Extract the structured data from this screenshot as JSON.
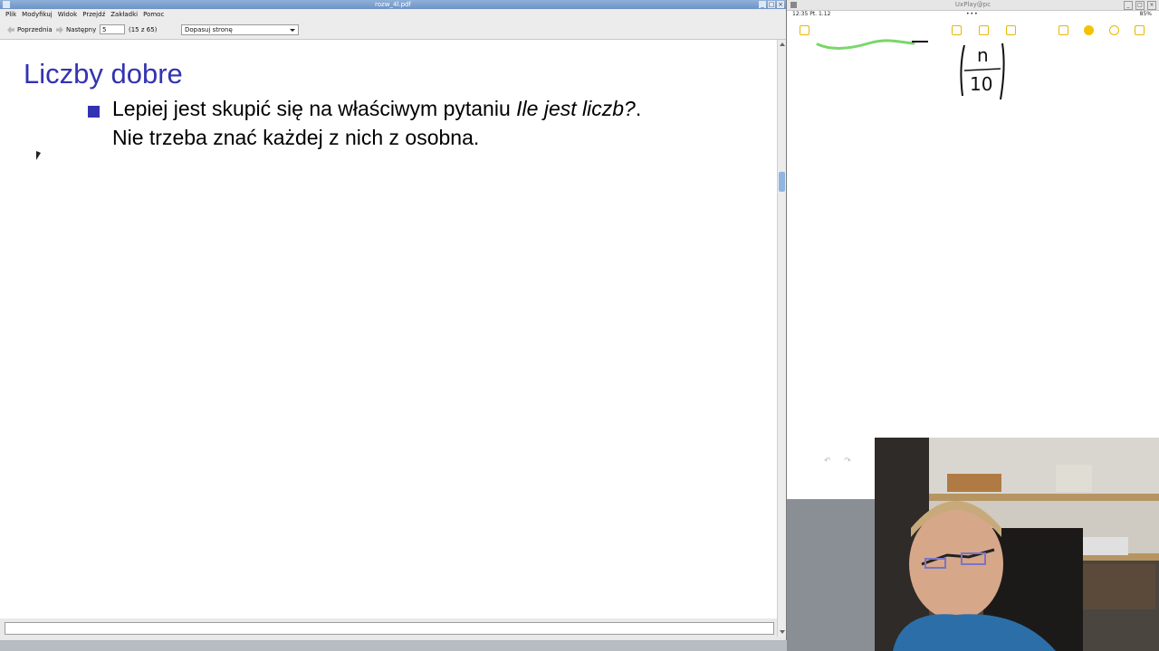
{
  "pdf_viewer": {
    "window_title": "rozw_4l.pdf",
    "menu": [
      "Plik",
      "Modyfikuj",
      "Widok",
      "Przejdź",
      "Zakładki",
      "Pomoc"
    ],
    "toolbar": {
      "prev_label": "Poprzednia",
      "next_label": "Następny",
      "page_value": "5",
      "page_count": "(15 z 65)",
      "zoom_value": "Dopasuj stronę"
    },
    "slide": {
      "title": "Liczby dobre",
      "bullet_line1_plain": "Lepiej jest skupić się na właściwym pytaniu ",
      "bullet_line1_italic": "Ile jest liczb?",
      "bullet_line1_end": ".",
      "bullet_line2": "Nie trzeba znać każdej z nich z osobna."
    },
    "colors": {
      "title": "#3333b2",
      "bullet": "#3333b2"
    }
  },
  "mirror": {
    "window_title": "UxPlay@pc",
    "status_time": "12:35  Pt. 1.12",
    "status_dots": "•••",
    "status_battery": "85%",
    "handwriting_numerator": "n",
    "handwriting_denominator": "10",
    "undo_icon": "undo-icon",
    "redo_icon": "redo-icon",
    "accent": "#e6b800"
  }
}
